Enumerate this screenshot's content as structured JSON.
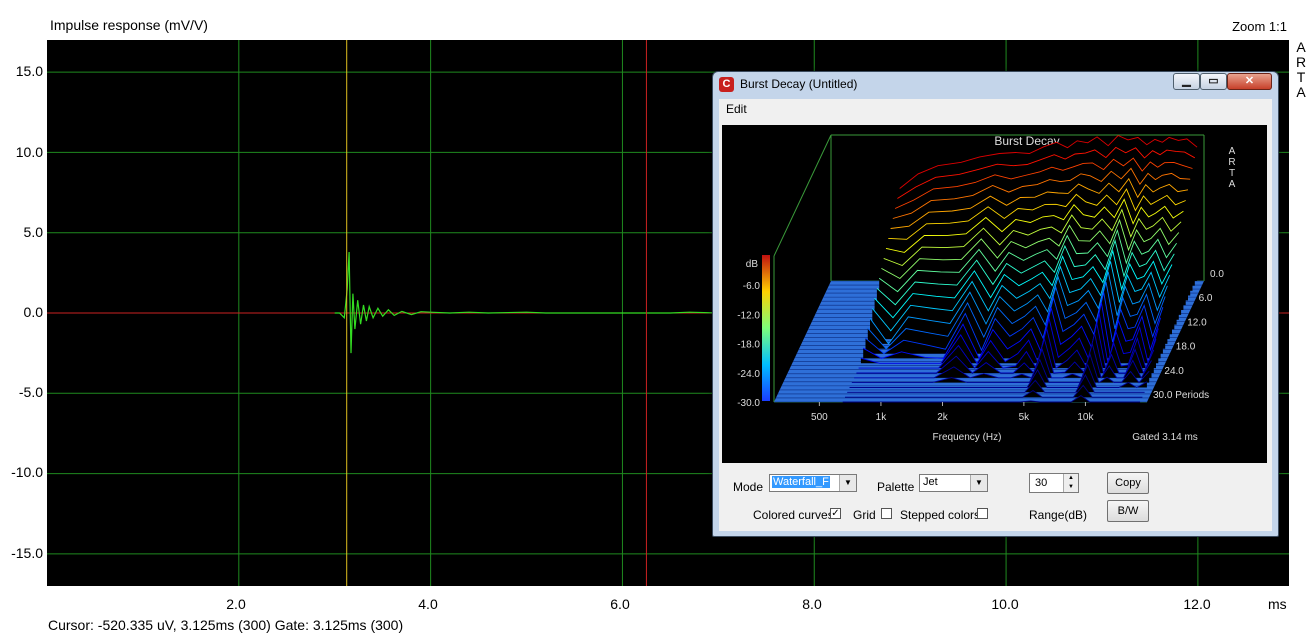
{
  "main": {
    "title": "Impulse response (mV/V)",
    "zoom": "Zoom 1:1",
    "side_mark": [
      "A",
      "R",
      "T",
      "A"
    ],
    "x_unit": "ms",
    "status": "Cursor: -520.335 uV, 3.125ms (300)  Gate: 3.125ms (300)"
  },
  "chart_data": [
    {
      "type": "line",
      "title": "Impulse response (mV/V)",
      "xlabel": "ms",
      "ylabel": "",
      "xlim": [
        0.0,
        12.95
      ],
      "ylim": [
        -17.0,
        17.0
      ],
      "x_ticks": [
        "2.0",
        "4.0",
        "6.0",
        "8.0",
        "10.0",
        "12.0"
      ],
      "y_ticks": [
        "15.0",
        "10.0",
        "5.0",
        "0.0",
        "-5.0",
        "-10.0",
        "-15.0"
      ],
      "grid": true,
      "cursor_ms": 3.125,
      "gate_ms": 6.25,
      "series": [
        {
          "x": [
            3.0,
            3.05,
            3.1,
            3.13,
            3.15,
            3.17,
            3.19,
            3.21,
            3.24,
            3.27,
            3.3,
            3.33,
            3.36,
            3.4,
            3.45,
            3.5,
            3.56,
            3.62,
            3.7,
            3.8,
            3.9,
            4.0,
            4.2,
            4.4,
            4.6,
            5.0,
            5.2,
            5.5,
            6.0,
            6.5,
            6.7,
            7.0
          ],
          "y": [
            0.0,
            0.0,
            -0.3,
            1.5,
            3.8,
            -2.5,
            1.2,
            -1.0,
            0.8,
            -0.7,
            0.5,
            -0.5,
            0.4,
            -0.3,
            0.3,
            -0.2,
            0.2,
            -0.15,
            0.1,
            -0.1,
            0.08,
            0.05,
            0.0,
            0.05,
            0.0,
            0.05,
            0.0,
            0.0,
            0.0,
            0.0,
            0.05,
            0.0
          ]
        }
      ]
    },
    {
      "type": "area",
      "title": "Burst Decay",
      "xlabel": "Frequency (Hz)",
      "ylabel": "dB",
      "x_ticks": [
        "500",
        "1k",
        "2k",
        "5k",
        "10k"
      ],
      "y_ticks": [
        "-6.0",
        "-12.0",
        "-18.0",
        "-24.0",
        "-30.0"
      ],
      "z_ticks": [
        "0.0",
        "6.0",
        "12.0",
        "18.0",
        "24.0",
        "30.0 Periods"
      ],
      "xlim": [
        300,
        20000
      ],
      "ylim": [
        -30,
        0
      ],
      "zlim": [
        0,
        30
      ],
      "gated_note": "Gated 3.14 ms",
      "side_mark": [
        "A",
        "R",
        "T",
        "A"
      ],
      "front_curve": {
        "freq": [
          650,
          800,
          1000,
          1300,
          1600,
          2000,
          2400,
          2800,
          3300,
          3800,
          4300,
          4800,
          5400,
          6000,
          6800,
          7600,
          8500,
          9500,
          10500,
          11500,
          12500,
          13500,
          15000,
          16500,
          18500
        ],
        "db": [
          -11,
          -8,
          -6.3,
          -5.6,
          -4.5,
          -3.8,
          -3.6,
          -3.8,
          -2.4,
          -1.5,
          -2.6,
          -1.2,
          -1.6,
          -0.4,
          -2.2,
          -0.1,
          -1.0,
          -0.5,
          -2.0,
          -0.9,
          -1.5,
          -0.5,
          -1.1,
          -0.8,
          -2.5
        ]
      }
    }
  ],
  "burst_window": {
    "title": "Burst Decay  (Untitled)",
    "app_icon": "arta-logo-icon",
    "min_label": "▁",
    "max_label": "▭",
    "close_label": "✕",
    "menu": [
      "Edit"
    ],
    "mode_label": "Mode",
    "mode_value": "Waterfall_F",
    "palette_label": "Palette",
    "palette_value": "Jet",
    "range_value": "30",
    "range_label": "Range(dB)",
    "copy_label": "Copy",
    "bw_label": "B/W",
    "colored_curves_label": "Colored curves",
    "colored_curves_checked": true,
    "grid_label": "Grid",
    "grid_checked": false,
    "stepped_colors_label": "Stepped colors",
    "stepped_colors_checked": false
  },
  "colors": {
    "plot_bg": "#000000",
    "grid": "#1f8a1f",
    "impulse": "#33dd22",
    "baseline": "#cc2222",
    "cursor": "#e0c020",
    "gate": "#cc2222",
    "floor_blue": "#2e6fd8"
  }
}
